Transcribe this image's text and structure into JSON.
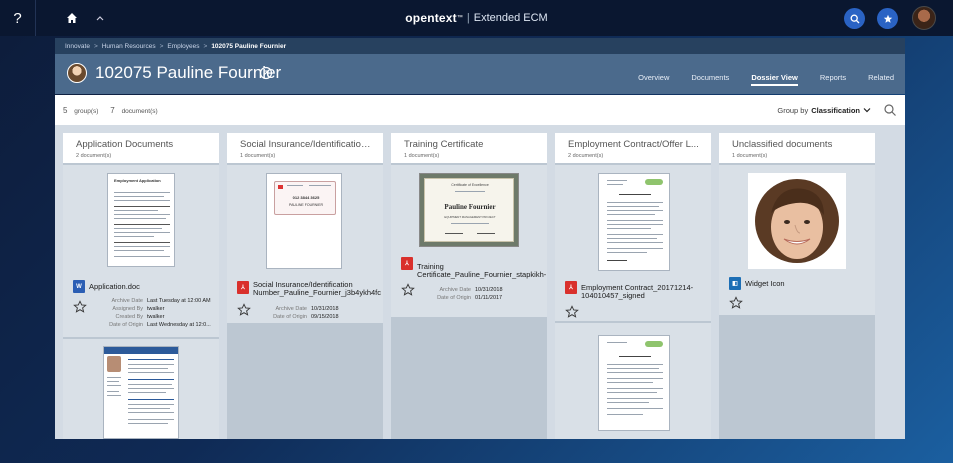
{
  "topbar": {
    "help_label": "?",
    "brand_logo": "opentext",
    "brand_tm": "™",
    "brand_separator": "|",
    "brand_product": "Extended ECM"
  },
  "breadcrumb": [
    "Innovate",
    "Human Resources",
    "Employees",
    "102075 Pauline Fournier"
  ],
  "breadcrumb_separator": ">",
  "header": {
    "title": "102075 Pauline Fournier",
    "tabs": [
      {
        "label": "Overview",
        "active": false
      },
      {
        "label": "Documents",
        "active": false
      },
      {
        "label": "Dossier View",
        "active": true
      },
      {
        "label": "Reports",
        "active": false
      },
      {
        "label": "Related",
        "active": false
      }
    ]
  },
  "toolbar": {
    "groups_count": "5",
    "groups_label": "group(s)",
    "docs_count": "7",
    "docs_label": "document(s)",
    "groupby_label": "Group by",
    "groupby_value": "Classification"
  },
  "columns": [
    {
      "title": "Application Documents",
      "count": "2 document(s)",
      "cards": [
        {
          "filename": "Application.doc",
          "icon": "word-icon",
          "meta": [
            {
              "k": "Archive Date",
              "v": "Last Tuesday at 12:00 AM"
            },
            {
              "k": "Assigned By",
              "v": "twalker"
            },
            {
              "k": "Created By",
              "v": "twalker"
            },
            {
              "k": "Date of Origin",
              "v": "Last Wednesday at 12:0..."
            }
          ]
        }
      ]
    },
    {
      "title": "Social Insurance/Identification...",
      "count": "1 document(s)",
      "cards": [
        {
          "filename": "Social Insurance/Identification",
          "filename2": "Number_Pauline_Fournier_j3b4ykh4fc",
          "icon": "pdf-icon",
          "meta": [
            {
              "k": "Archive Date",
              "v": "10/31/2018"
            },
            {
              "k": "Date of Origin",
              "v": "09/15/2018"
            }
          ]
        }
      ]
    },
    {
      "title": "Training Certificate",
      "count": "1 document(s)",
      "cards": [
        {
          "filename": "Training",
          "filename2": "Certificate_Pauline_Fournier_stapkikh-",
          "icon": "pdf-icon",
          "cert_heading": "Certificate of Excellence",
          "cert_name": "Pauline Fournier",
          "cert_subtitle": "EQUIPMENT MANAGEMENT PROJECT",
          "meta": [
            {
              "k": "Archive Date",
              "v": "10/31/2018"
            },
            {
              "k": "Date of Origin",
              "v": "01/11/2017"
            }
          ]
        }
      ]
    },
    {
      "title": "Employment Contract/Offer L...",
      "count": "2 document(s)",
      "cards": [
        {
          "filename": "Employment Contract_20171214-",
          "filename2": "104010457_signed",
          "icon": "pdf-icon"
        }
      ]
    },
    {
      "title": "Unclassified documents",
      "count": "1 document(s)",
      "cards": [
        {
          "filename": "Widget Icon",
          "icon": "widget-icon"
        }
      ]
    }
  ],
  "thumb_snippets": {
    "application_doc": "Employment Application",
    "id_card_number": "012 3844 3625",
    "id_card_name": "PAULINE FOURNIER"
  }
}
